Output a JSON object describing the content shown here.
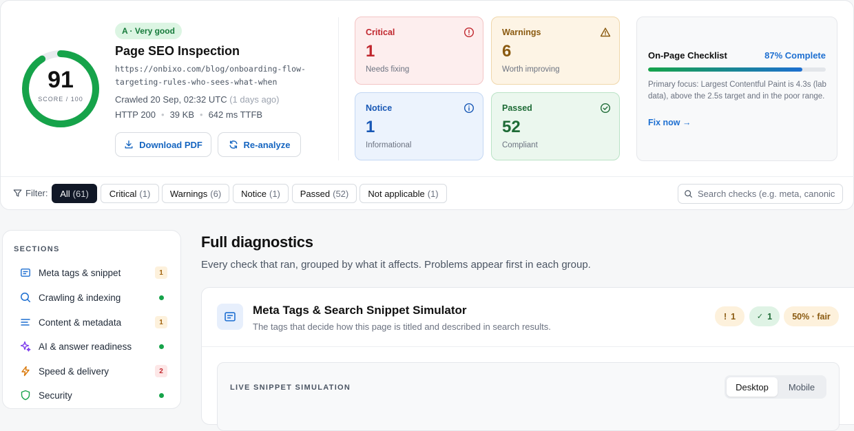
{
  "header": {
    "score": "91",
    "score_sub": "SCORE / 100",
    "score_fraction": 0.91,
    "grade": "A · Very good",
    "title": "Page SEO Inspection",
    "url": "https://onbixo.com/blog/onboarding-flow-targeting-rules-who-sees-what-when",
    "crawled": "Crawled 20 Sep, 02:32 UTC",
    "crawled_ago": "(1 days ago)",
    "http": "HTTP 200",
    "size": "39 KB",
    "ttfb": "642 ms TTFB",
    "download_label": "Download PDF",
    "reanalyze_label": "Re-analyze"
  },
  "stats": {
    "critical": {
      "label": "Critical",
      "value": "1",
      "desc": "Needs fixing"
    },
    "warnings": {
      "label": "Warnings",
      "value": "6",
      "desc": "Worth improving"
    },
    "notice": {
      "label": "Notice",
      "value": "1",
      "desc": "Informational"
    },
    "passed": {
      "label": "Passed",
      "value": "52",
      "desc": "Compliant"
    }
  },
  "checklist": {
    "title": "On-Page Checklist",
    "percent_label": "87% Complete",
    "percent": 87,
    "text": "Primary focus: Largest Contentful Paint is 4.3s (lab data), above the 2.5s target and in the poor range.",
    "link": "Fix now →"
  },
  "filter": {
    "label": "Filter:",
    "chips": [
      {
        "label": "All",
        "count": "(61)"
      },
      {
        "label": "Critical",
        "count": "(1)"
      },
      {
        "label": "Warnings",
        "count": "(6)"
      },
      {
        "label": "Notice",
        "count": "(1)"
      },
      {
        "label": "Passed",
        "count": "(52)"
      },
      {
        "label": "Not applicable",
        "count": "(1)"
      }
    ],
    "search_placeholder": "Search checks (e.g. meta, canonical)"
  },
  "sidebar": {
    "heading": "SECTIONS",
    "items": [
      {
        "label": "Meta tags & snippet",
        "badge": "1"
      },
      {
        "label": "Crawling & indexing",
        "badge": ""
      },
      {
        "label": "Content & metadata",
        "badge": "1"
      },
      {
        "label": "AI & answer readiness",
        "badge": ""
      },
      {
        "label": "Speed & delivery",
        "badge": "2"
      },
      {
        "label": "Security",
        "badge": ""
      }
    ]
  },
  "main": {
    "title": "Full diagnostics",
    "subtitle": "Every check that ran, grouped by what it affects. Problems appear first in each group.",
    "group": {
      "title": "Meta Tags & Search Snippet Simulator",
      "subtitle": "The tags that decide how this page is titled and described in search results.",
      "warn_count": "1",
      "ok_count": "1",
      "score_pill": "50% · fair",
      "sim_heading": "LIVE SNIPPET SIMULATION",
      "seg_desktop": "Desktop",
      "seg_mobile": "Mobile"
    }
  },
  "colors": {
    "score_ring": "#16a34a",
    "accent": "#1d6fd1",
    "critical": "#c0262d",
    "warning": "#8a5a10",
    "passed": "#1e6b36"
  }
}
